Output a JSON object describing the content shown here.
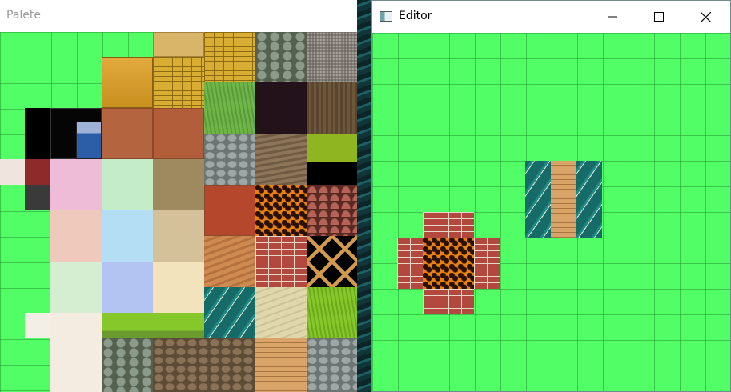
{
  "palette_window": {
    "title": "Palete"
  },
  "editor_window": {
    "title": "Editor",
    "controls": {
      "minimize_icon": "minimize-icon",
      "maximize_icon": "maximize-icon",
      "close_icon": "close-icon"
    }
  },
  "colors": {
    "grass": "#51fe65",
    "grid_line": "#2a9637",
    "brick": "#b3483e",
    "lava": "#e8820e",
    "water": "#1e8a86",
    "plank": "#d9a468"
  }
}
